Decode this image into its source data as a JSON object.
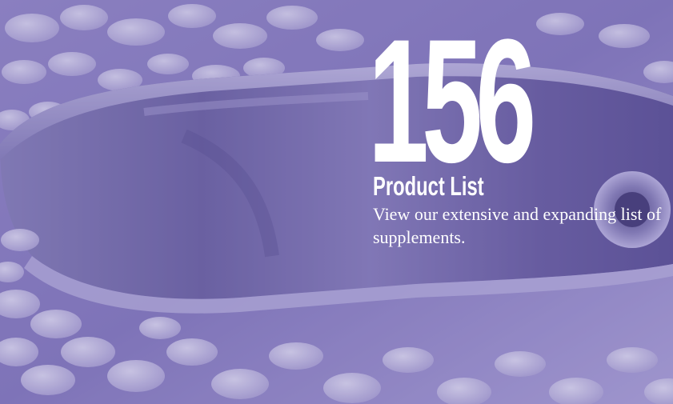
{
  "promo": {
    "count": "156",
    "title": "Product List",
    "description": "View our extensive and expanding list of supplements."
  },
  "colors": {
    "overlay": "#6B5DB0",
    "text": "#FFFFFF"
  },
  "icons": {
    "background": "supplement-scoop-photo"
  }
}
